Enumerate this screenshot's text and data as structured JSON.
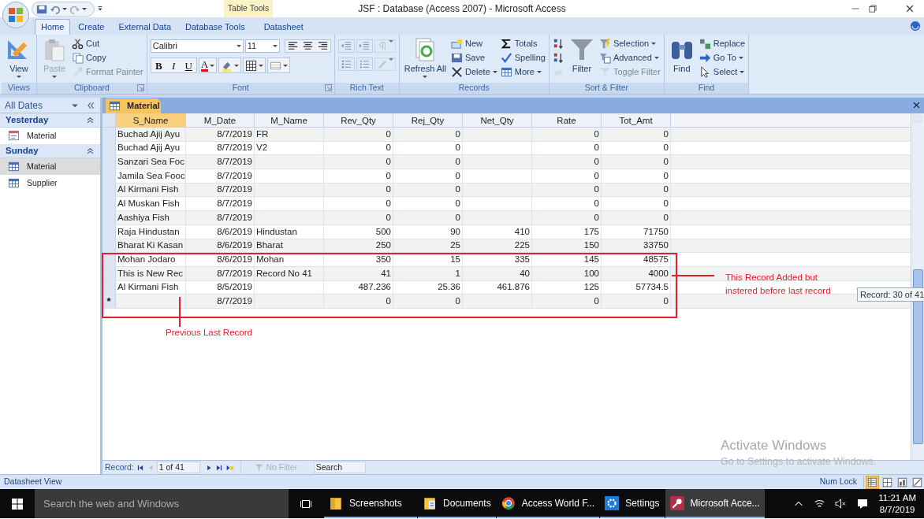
{
  "title_bar": {
    "contextual_tab": "Table Tools",
    "title": "JSF : Database (Access 2007) - Microsoft Access"
  },
  "ribbon": {
    "tabs": [
      {
        "label": "Home",
        "selected": true
      },
      {
        "label": "Create",
        "selected": false
      },
      {
        "label": "External Data",
        "selected": false
      },
      {
        "label": "Database Tools",
        "selected": false
      },
      {
        "label": "Datasheet",
        "selected": false
      }
    ],
    "groups": [
      {
        "label": "Views",
        "parts": [
          {
            "kind": "large",
            "items": [
              {
                "label": "View",
                "dropdown": true,
                "disabled": false
              }
            ]
          }
        ]
      },
      {
        "label": "Clipboard",
        "launcher": true,
        "parts": [
          {
            "kind": "large",
            "items": [
              {
                "label": "Paste",
                "dropdown": true,
                "disabled": true
              }
            ]
          },
          {
            "kind": "column",
            "items": [
              {
                "label": "Cut",
                "dropdown": false,
                "disabled": false
              },
              {
                "label": "Copy",
                "dropdown": false,
                "disabled": false
              },
              {
                "label": "Format Painter",
                "dropdown": false,
                "disabled": true
              }
            ]
          }
        ]
      },
      {
        "label": "Font",
        "launcher": true,
        "parts": [
          {
            "kind": "font",
            "font": "Calibri",
            "size": "11",
            "styles": [
              "B",
              "I",
              "U"
            ],
            "color_letter": "A"
          }
        ]
      },
      {
        "label": "Rich Text",
        "launcher": false,
        "parts": [
          {
            "kind": "icon_rows"
          }
        ]
      },
      {
        "label": "Records",
        "launcher": false,
        "parts": [
          {
            "kind": "large",
            "items": [
              {
                "label": "Refresh All",
                "dropdown": true,
                "disabled": false
              }
            ]
          },
          {
            "kind": "column",
            "items": [
              {
                "label": "New",
                "dropdown": false,
                "disabled": false
              },
              {
                "label": "Save",
                "dropdown": false,
                "disabled": false
              },
              {
                "label": "Delete",
                "dropdown": true,
                "disabled": false
              }
            ]
          },
          {
            "kind": "column",
            "items": [
              {
                "label": "Totals",
                "dropdown": false,
                "disabled": false
              },
              {
                "label": "Spelling",
                "dropdown": false,
                "disabled": false
              },
              {
                "label": "More",
                "dropdown": true,
                "disabled": false
              }
            ]
          }
        ]
      },
      {
        "label": "Sort & Filter",
        "launcher": false,
        "parts": [
          {
            "kind": "column",
            "items": [
              {
                "dropdown": false,
                "disabled": false
              },
              {
                "dropdown": false,
                "disabled": false
              },
              {
                "dropdown": false,
                "disabled": true
              }
            ]
          },
          {
            "kind": "large",
            "items": [
              {
                "label": "Filter",
                "dropdown": false,
                "disabled": false
              }
            ]
          },
          {
            "kind": "column",
            "items": [
              {
                "label": "Selection",
                "dropdown": true,
                "disabled": false
              },
              {
                "label": "Advanced",
                "dropdown": true,
                "disabled": false
              },
              {
                "label": "Toggle Filter",
                "dropdown": false,
                "disabled": true
              }
            ]
          }
        ]
      },
      {
        "label": "Find",
        "launcher": false,
        "parts": [
          {
            "kind": "large",
            "items": [
              {
                "label": "Find",
                "dropdown": false,
                "disabled": false
              }
            ]
          },
          {
            "kind": "column",
            "items": [
              {
                "label": "Replace",
                "dropdown": false,
                "disabled": false
              },
              {
                "label": "Go To",
                "dropdown": true,
                "disabled": false
              },
              {
                "label": "Select",
                "dropdown": true,
                "disabled": false
              }
            ]
          }
        ]
      }
    ]
  },
  "navigation_pane": {
    "header": "All Dates",
    "groups": [
      {
        "label": "Yesterday",
        "items": [
          {
            "label": "Material",
            "kind": "form",
            "selected": false
          }
        ]
      },
      {
        "label": "Sunday",
        "items": [
          {
            "label": "Material",
            "kind": "table",
            "selected": true
          },
          {
            "label": "Supplier",
            "kind": "table",
            "selected": false
          }
        ]
      }
    ]
  },
  "document_tab": {
    "label": "Material"
  },
  "table": {
    "columns": [
      {
        "label": "S_Name",
        "kind": "text",
        "selected": true
      },
      {
        "label": "M_Date",
        "kind": "number",
        "selected": false
      },
      {
        "label": "M_Name",
        "kind": "text",
        "selected": false
      },
      {
        "label": "Rev_Qty",
        "kind": "number",
        "selected": false
      },
      {
        "label": "Rej_Qty",
        "kind": "number",
        "selected": false
      },
      {
        "label": "Net_Qty",
        "kind": "number",
        "selected": false
      },
      {
        "label": "Rate",
        "kind": "number",
        "selected": false
      },
      {
        "label": "Tot_Amt",
        "kind": "number",
        "selected": false
      }
    ],
    "rows": [
      {
        "kind": "record",
        "cells": [
          "Buchad Ajij Ayu",
          "8/7/2019",
          "FR",
          "0",
          "0",
          null,
          "0",
          "0"
        ]
      },
      {
        "kind": "record",
        "cells": [
          "Buchad Ajij Ayu",
          "8/7/2019",
          "V2",
          "0",
          "0",
          null,
          "0",
          "0"
        ]
      },
      {
        "kind": "record",
        "cells": [
          "Sanzari Sea Foc",
          "8/7/2019",
          null,
          "0",
          "0",
          null,
          "0",
          "0"
        ]
      },
      {
        "kind": "record",
        "cells": [
          "Jamila Sea Fooc",
          "8/7/2019",
          null,
          "0",
          "0",
          null,
          "0",
          "0"
        ]
      },
      {
        "kind": "record",
        "cells": [
          "Al Kirmani Fish",
          "8/7/2019",
          null,
          "0",
          "0",
          null,
          "0",
          "0"
        ]
      },
      {
        "kind": "record",
        "cells": [
          "Al Muskan Fish",
          "8/7/2019",
          null,
          "0",
          "0",
          null,
          "0",
          "0"
        ]
      },
      {
        "kind": "record",
        "cells": [
          "Aashiya Fish",
          "8/7/2019",
          null,
          "0",
          "0",
          null,
          "0",
          "0"
        ]
      },
      {
        "kind": "record",
        "cells": [
          "Raja Hindustan",
          "8/6/2019",
          "Hindustan",
          "500",
          "90",
          "410",
          "175",
          "71750"
        ]
      },
      {
        "kind": "record",
        "cells": [
          "Bharat Ki Kasan",
          "8/6/2019",
          "Bharat",
          "250",
          "25",
          "225",
          "150",
          "33750"
        ]
      },
      {
        "kind": "record",
        "cells": [
          "Mohan Jodaro",
          "8/6/2019",
          "Mohan",
          "350",
          "15",
          "335",
          "145",
          "48575"
        ]
      },
      {
        "kind": "record",
        "cells": [
          "This is New Rec",
          "8/7/2019",
          "Record No 41",
          "41",
          "1",
          "40",
          "100",
          "4000"
        ]
      },
      {
        "kind": "record",
        "cells": [
          "Al Kirmani Fish",
          "8/5/2019",
          null,
          "487.236",
          "25.36",
          "461.876",
          "125",
          "57734.5"
        ]
      },
      {
        "kind": "new",
        "marker": "*",
        "cells": [
          null,
          "8/7/2019",
          null,
          "0",
          "0",
          null,
          "0",
          "0"
        ]
      }
    ]
  },
  "record_navigation": {
    "label": "Record:",
    "position": "1 of 41",
    "filter": "No Filter",
    "search_placeholder": "Search"
  },
  "tooltip": "Record: 30 of 41",
  "annotations": [
    {
      "kind": "below",
      "text": "Previous Last Record"
    },
    {
      "kind": "right",
      "text": "This Record Added but instered before last record"
    }
  ],
  "activation_notice": {
    "title": "Activate Windows",
    "message": "Go to Settings to activate Windows."
  },
  "status_bar": {
    "left": "Datasheet View",
    "right": "Num Lock",
    "views": [
      {
        "selected": true
      },
      {
        "selected": false
      },
      {
        "selected": false
      },
      {
        "selected": false
      }
    ]
  },
  "taskbar": {
    "search_placeholder": "Search the web and Windows",
    "apps": [
      {
        "label": "Screenshots",
        "kind": "folder",
        "selected": false
      },
      {
        "label": "Documents",
        "kind": "documents",
        "selected": false
      },
      {
        "label": "Access World F...",
        "kind": "browser",
        "selected": false
      },
      {
        "label": "Settings",
        "kind": "settings",
        "selected": false
      },
      {
        "label": "Microsoft Acce...",
        "kind": "access",
        "selected": true
      }
    ],
    "time": "11:21 AM",
    "date": "8/7/2019"
  }
}
